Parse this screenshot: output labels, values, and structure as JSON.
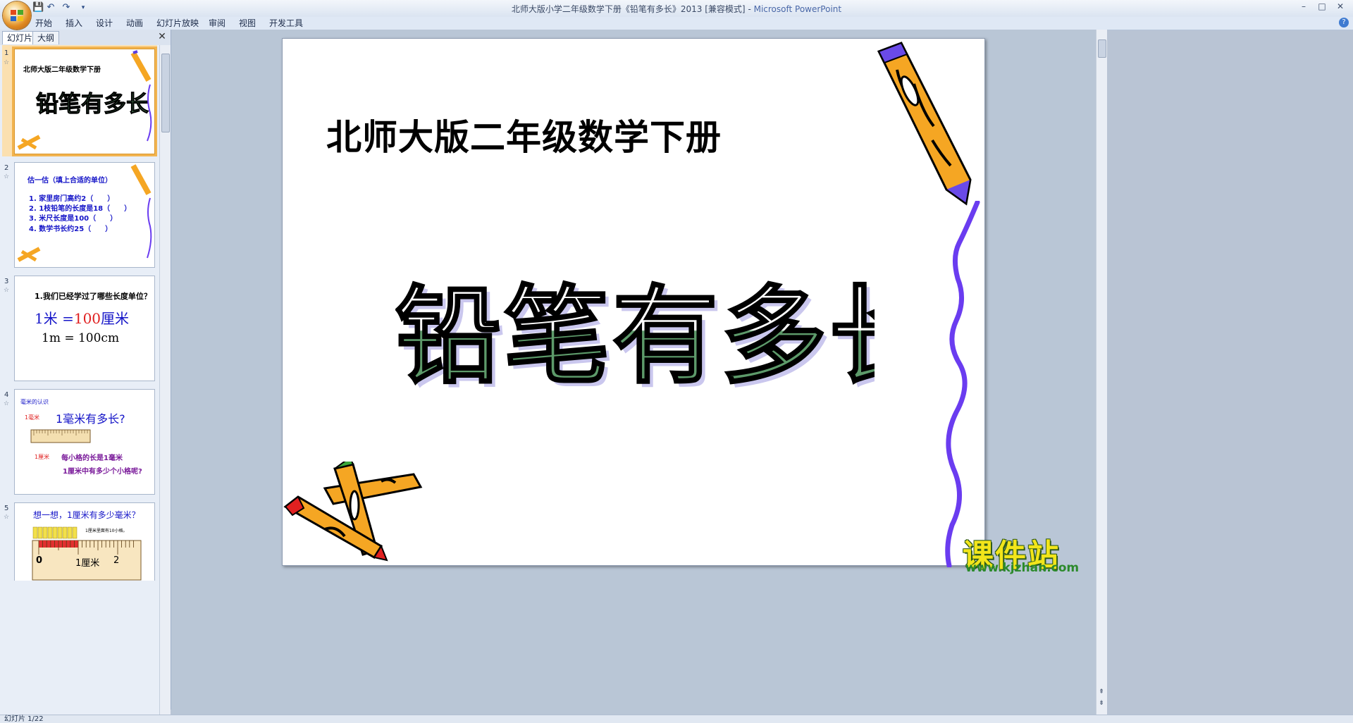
{
  "window": {
    "title_doc": "北师大版小学二年级数学下册《铅笔有多长》2013 [兼容模式]",
    "title_sep": " - ",
    "title_app": "Microsoft PowerPoint",
    "minimize": "–",
    "maximize": "□",
    "close": "✕"
  },
  "quick_access": {
    "save": "💾",
    "undo": "↶",
    "redo": "↷",
    "more": "▾"
  },
  "menu": {
    "items": [
      "开始",
      "插入",
      "设计",
      "动画",
      "幻灯片放映",
      "审阅",
      "视图",
      "开发工具"
    ],
    "help": "?"
  },
  "panel": {
    "tabs": [
      "幻灯片",
      "大纲"
    ],
    "close": "✕"
  },
  "thumbnails": [
    {
      "num": "1",
      "title": "北师大版二年级数学下册",
      "art": "铅笔有多长"
    },
    {
      "num": "2",
      "heading": "估一估（填上合适的单位）",
      "lines": [
        "1. 家里房门高约2（　　）",
        "2. 1枝铅笔的长度是18（　　）",
        "3. 米尺长度是100（　　）",
        "4. 数学书长约25（　　）"
      ]
    },
    {
      "num": "3",
      "question": "1.我们已经学过了哪些长度单位？",
      "eq_a": "1米",
      "eq_eq": "=",
      "eq_b": "100",
      "eq_c": "厘米",
      "eq2": "1m = 100cm"
    },
    {
      "num": "4",
      "label": "毫米的认识",
      "mm_label": "1毫米",
      "head": "1毫米有多长?",
      "cm_label": "1厘米",
      "line1": "每小格的长是1毫米",
      "line2": "1厘米中有多少个小格呢?"
    },
    {
      "num": "5",
      "head": "想一想，1厘米有多少毫米？",
      "note": "1厘米里面有10小格。",
      "ruler": [
        "0",
        "1厘米",
        "2"
      ]
    }
  ],
  "slide": {
    "title": "北师大版二年级数学下册",
    "wordart": "铅笔有多长"
  },
  "status": {
    "text": "幻灯片 1/22"
  },
  "watermark": {
    "title": "课件站",
    "url": "www.kjzhan.com"
  },
  "colors": {
    "accent": "#f2b450",
    "wordart_fill": "#5d9a6a",
    "pencil_orange": "#f5a623",
    "squiggle": "#6a3cf0"
  }
}
